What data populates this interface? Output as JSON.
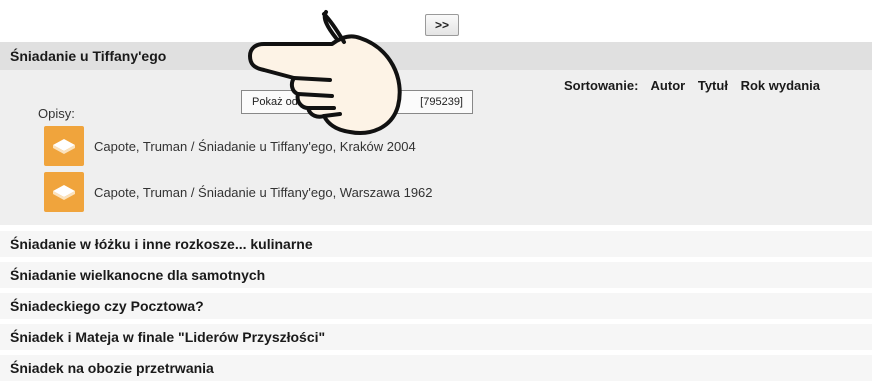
{
  "pager": {
    "next_label": ">>"
  },
  "expanded_item": {
    "title": "Śniadanie u Tiffany'ego",
    "sort": {
      "label": "Sortowanie:",
      "options": [
        "Autor",
        "Tytuł",
        "Rok wydania"
      ]
    },
    "descriptions_label": "Opisy:",
    "show_button": {
      "label": "Pokaż od",
      "count": "[795239]"
    },
    "descriptions": [
      {
        "icon": "book-icon",
        "text": "Capote, Truman / Śniadanie u Tiffany'ego, Kraków 2004"
      },
      {
        "icon": "book-icon",
        "text": "Capote, Truman / Śniadanie u Tiffany'ego, Warszawa 1962"
      }
    ]
  },
  "results": [
    "Śniadanie w łóżku i inne rozkosze... kulinarne",
    "Śniadanie wielkanocne dla samotnych",
    "Śniadeckiego czy Pocztowa?",
    "Śniadek i Mateja w finale \"Liderów Przyszłości\"",
    "Śniadek na obozie przetrwania"
  ],
  "overlay": {
    "icon": "pointing-hand-icon"
  },
  "colors": {
    "book_icon": "#f0a43c",
    "title_bar": "#e0e0e0",
    "panel": "#efefef"
  }
}
